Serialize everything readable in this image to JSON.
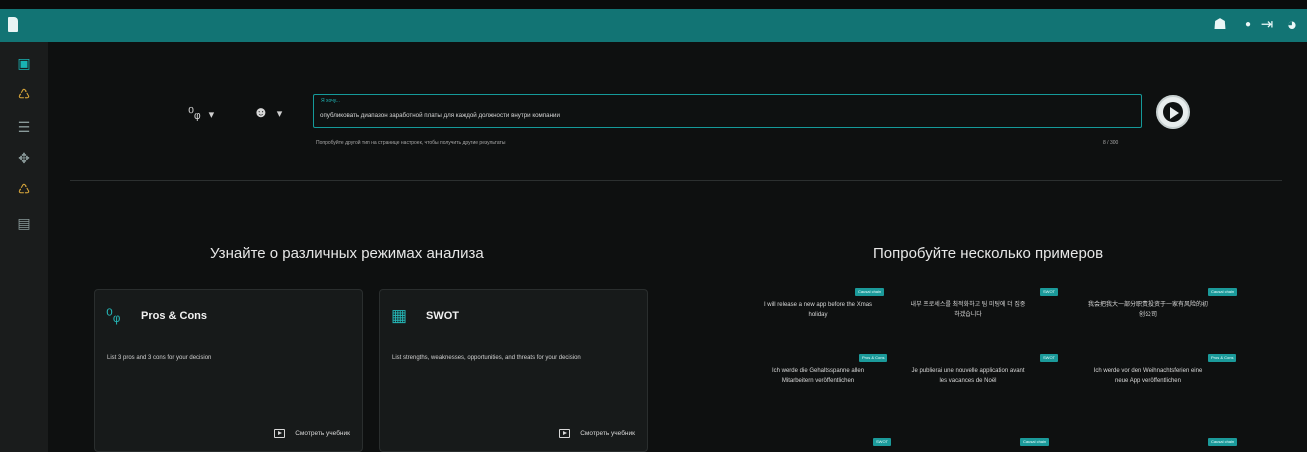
{
  "header": {
    "icons": [
      "app-logo-icon",
      "discord-icon",
      "dot-icon",
      "logout-icon",
      "avatar-icon"
    ]
  },
  "sidebar": {
    "items": [
      {
        "icon": "document-icon",
        "glyph": "▣"
      },
      {
        "icon": "ideas-icon",
        "glyph": "♺"
      },
      {
        "icon": "list-icon",
        "glyph": "☰"
      },
      {
        "icon": "compass-icon",
        "glyph": "✥"
      },
      {
        "icon": "ideas-alt-icon",
        "glyph": "♺"
      },
      {
        "icon": "table-icon",
        "glyph": "▤"
      }
    ]
  },
  "query": {
    "mode_icon": "⁰ᵩ",
    "tone_icon": "☻",
    "dropdown": "▾",
    "label": "Я хочу...",
    "value": "опубликовать диапазон заработной платы для каждой должности внутри компании",
    "hint": "Попробуйте другой тип на странице настроек, чтобы получить другие результаты",
    "counter": "8 / 300"
  },
  "learn": {
    "title": "Узнайте о различных режимах анализа",
    "cards": [
      {
        "icon": "⁰ᵩ",
        "title": "Pros & Cons",
        "desc": "List 3 pros and 3 cons for your decision",
        "button": "Смотреть учебник"
      },
      {
        "icon": "▦",
        "title": "SWOT",
        "desc": "List strengths, weaknesses, opportunities, and threats for your decision",
        "button": "Смотреть учебник"
      }
    ]
  },
  "examples": {
    "title": "Попробуйте несколько примеров",
    "items": [
      {
        "tag": "Causal chain",
        "text": "I will release a new app before the Xmas holiday"
      },
      {
        "tag": "SWOT",
        "text": "내부 프로세스를 최적화하고 팀 미팅에 더 집중하겠습니다"
      },
      {
        "tag": "Causal chain",
        "text": "我会把我大一部分职责投资于一家有风险的初创公司"
      },
      {
        "tag": "Pros & Cons",
        "text": "Ich werde die Gehaltsspanne allen Mitarbeitern veröffentlichen"
      },
      {
        "tag": "SWOT",
        "text": "Je publierai une nouvelle application avant les vacances de Noël"
      },
      {
        "tag": "Pros & Cons",
        "text": "Ich werde vor den Weihnachtsferien eine neue App veröffentlichen"
      },
      {
        "tag": "SWOT",
        "text": ""
      },
      {
        "tag": "Causal chain",
        "text": ""
      },
      {
        "tag": "Causal chain",
        "text": ""
      }
    ]
  },
  "colors": {
    "accent": "#127474",
    "teal": "#1b9a9a"
  }
}
